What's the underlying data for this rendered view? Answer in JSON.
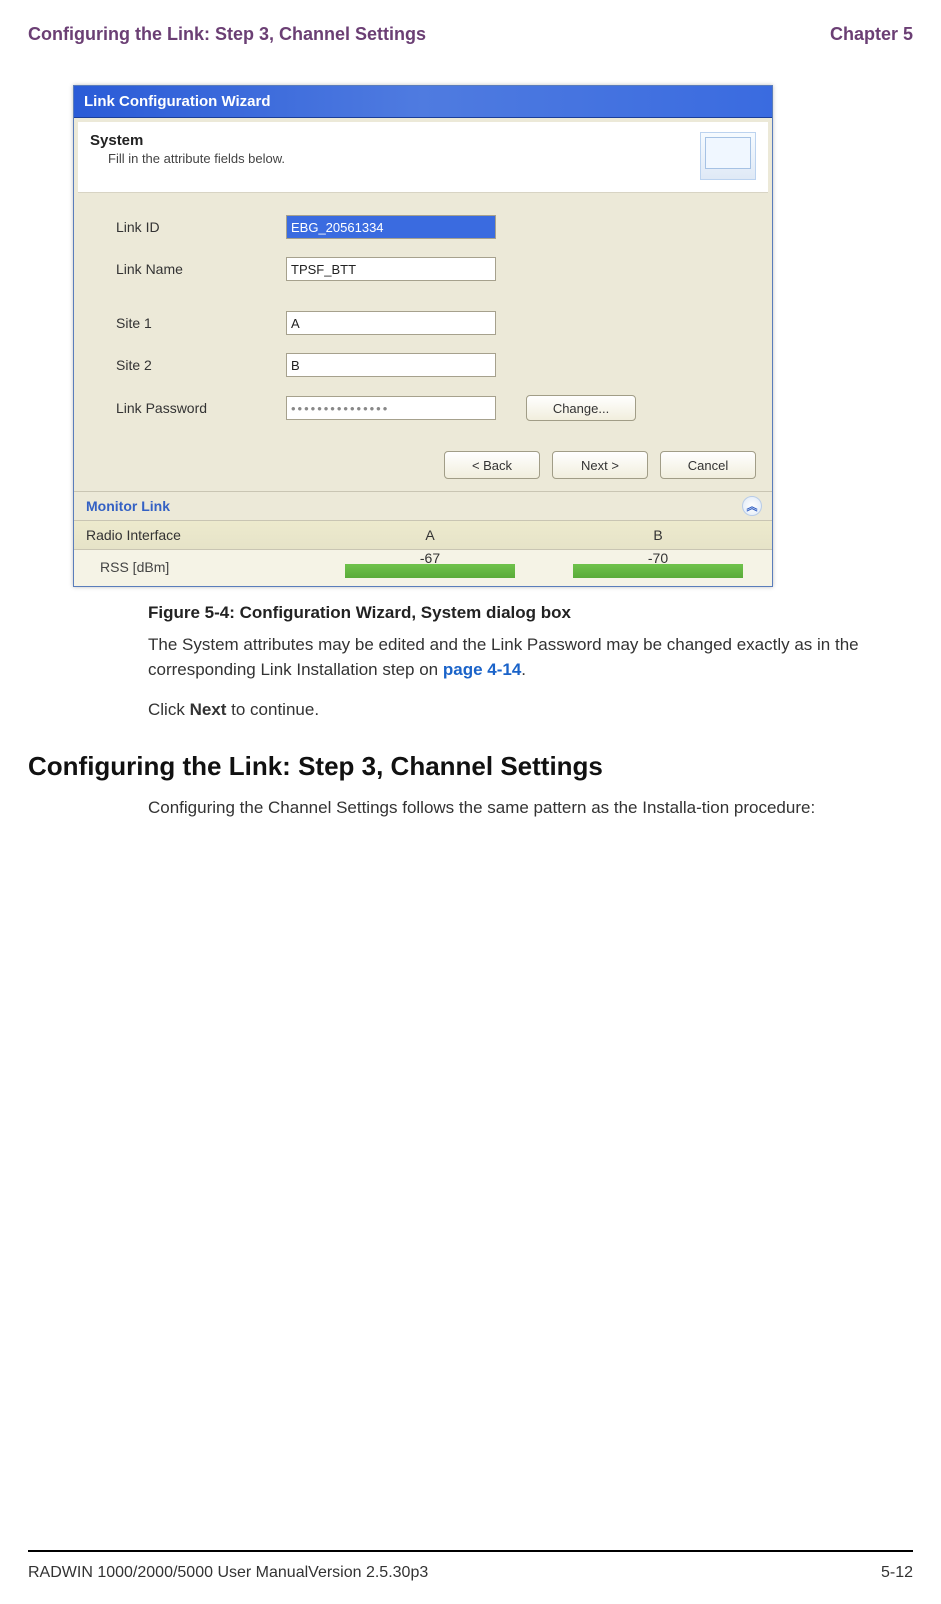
{
  "header": {
    "left": "Configuring the Link: Step 3, Channel Settings",
    "right": "Chapter 5"
  },
  "dialog": {
    "title": "Link Configuration Wizard",
    "system_title": "System",
    "system_sub": "Fill in the attribute fields below.",
    "fields": {
      "link_id_label": "Link ID",
      "link_id_value": "EBG_20561334",
      "link_name_label": "Link Name",
      "link_name_value": "TPSF_BTT",
      "site1_label": "Site 1",
      "site1_value": "A",
      "site2_label": "Site 2",
      "site2_value": "B",
      "link_password_label": "Link Password",
      "link_password_value": "•••••••••••••••",
      "change_btn": "Change..."
    },
    "nav": {
      "back": "< Back",
      "next": "Next >",
      "cancel": "Cancel"
    },
    "monitor_link": {
      "label": "Monitor Link",
      "radio_iface": "Radio Interface",
      "col_a": "A",
      "col_b": "B",
      "rss_label": "RSS [dBm]",
      "rss_a": "-67",
      "rss_b": "-70"
    }
  },
  "caption": "Figure 5-4: Configuration Wizard, System dialog box",
  "para1_a": "The System attributes may be edited and the Link Password may be changed exactly as in the corresponding Link Installation step on ",
  "para1_link": "page 4-14",
  "para1_b": ".",
  "para2_a": "Click ",
  "para2_bold": "Next",
  "para2_b": " to continue.",
  "section_heading": "Configuring the Link: Step 3, Channel Settings",
  "para3": "Configuring the Channel Settings follows the same pattern as the Installa-tion procedure:",
  "footer": {
    "left": "RADWIN 1000/2000/5000 User ManualVersion  2.5.30p3",
    "right": "5-12"
  }
}
